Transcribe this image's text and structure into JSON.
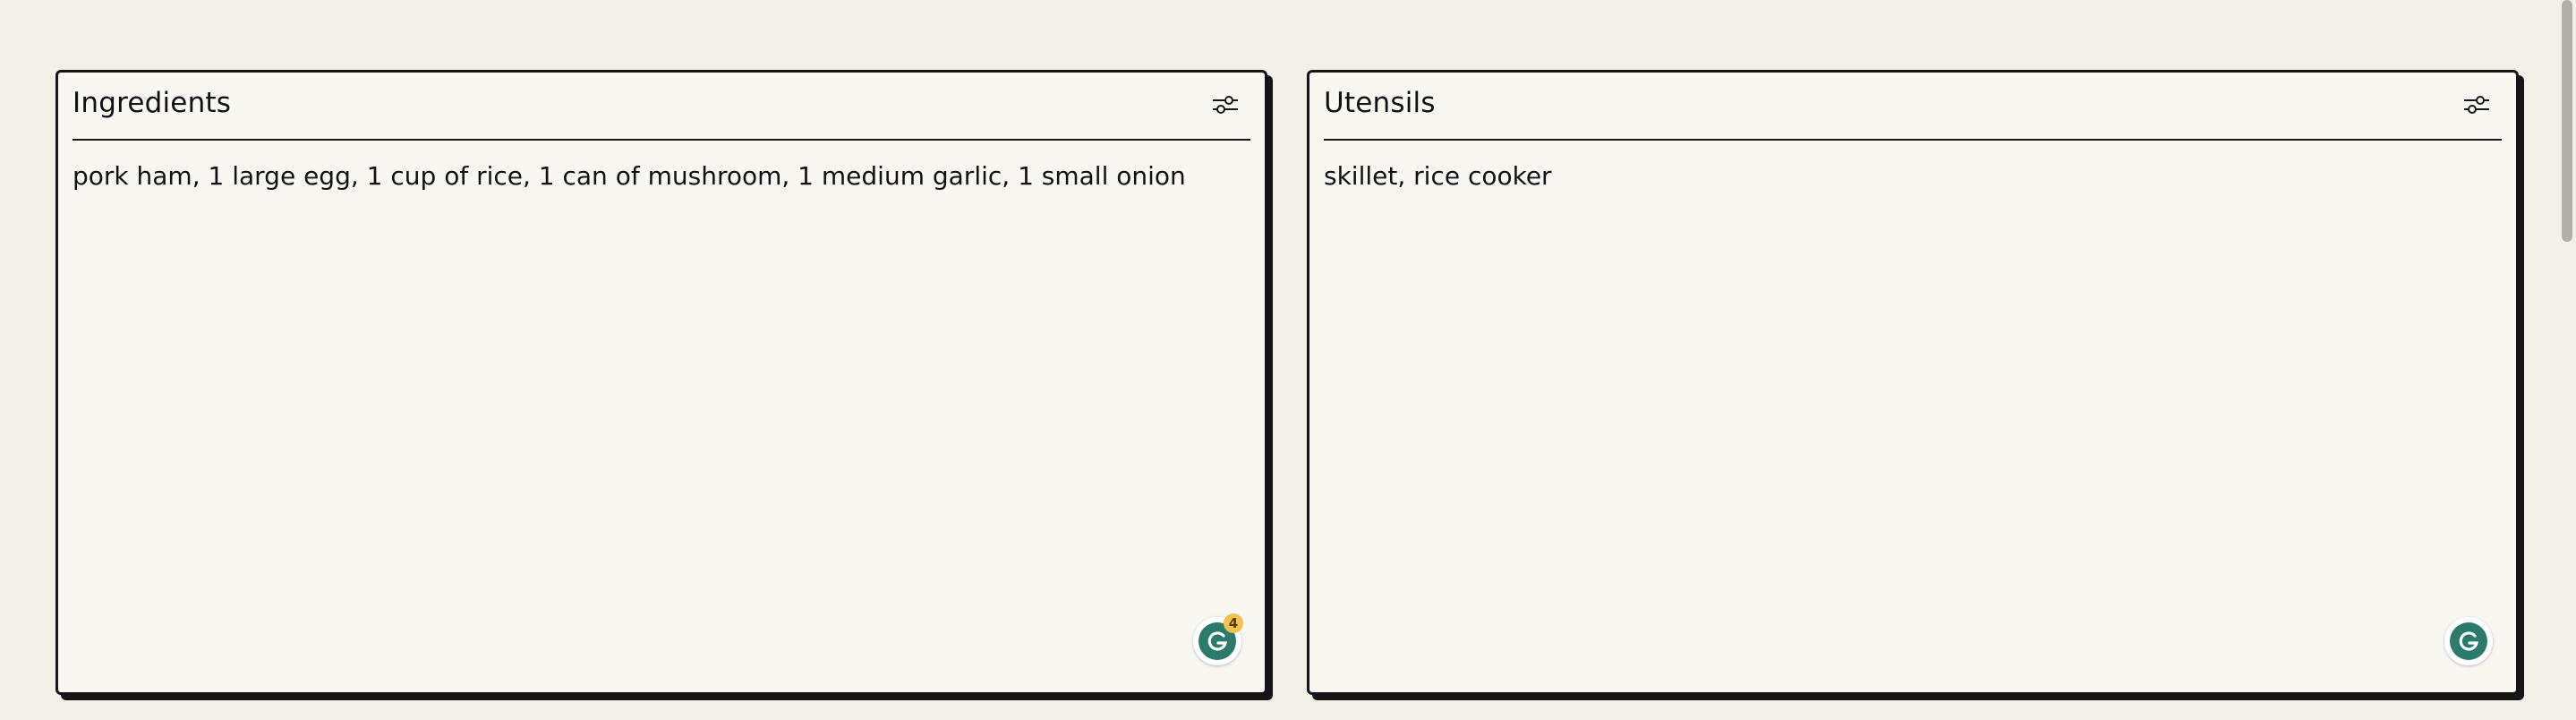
{
  "panels": [
    {
      "title": "Ingredients",
      "text": "pork ham, 1 large egg, 1 cup of rice, 1 can of mushroom, 1 medium garlic, 1 small onion",
      "settings_icon": "sliders-icon",
      "grammarly_badge": "4"
    },
    {
      "title": "Utensils",
      "text": "skillet, rice cooker",
      "settings_icon": "sliders-icon",
      "grammarly_badge": ""
    }
  ],
  "colors": {
    "background": "#f2f0e7",
    "panel": "#f8f7f2",
    "border": "#151515",
    "grammarly": "#2b7a6b",
    "badge": "#f2c14e"
  }
}
